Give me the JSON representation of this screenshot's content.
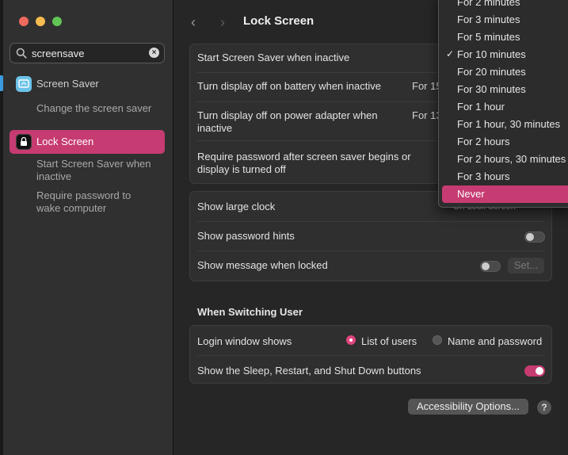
{
  "window": {
    "title": "Lock Screen"
  },
  "search": {
    "value": "screensave"
  },
  "sidebar": {
    "items": [
      {
        "label": "Screen Saver",
        "sub": [
          "Change the screen saver"
        ],
        "icon": "screen-saver-icon"
      },
      {
        "label": "Lock Screen",
        "sub": [
          "Start Screen Saver when inactive",
          "Require password to wake computer"
        ],
        "icon": "lock-screen-icon",
        "selected": true
      }
    ]
  },
  "settings": {
    "group1": [
      {
        "label": "Start Screen Saver when inactive"
      },
      {
        "label": "Turn display off on battery when inactive",
        "value": "For 15"
      },
      {
        "label": "Turn display off on power adapter when inactive",
        "value": "For 13"
      },
      {
        "label": "Require password after screen saver begins or display is turned off"
      }
    ],
    "group2": [
      {
        "label": "Show large clock",
        "value": "On Lock Screen"
      },
      {
        "label": "Show password hints",
        "toggle": false
      },
      {
        "label": "Show message when locked",
        "toggle": false,
        "button": "Set..."
      }
    ],
    "switching_header": "When Switching User",
    "group3": [
      {
        "label": "Login window shows",
        "options": [
          "List of users",
          "Name and password"
        ],
        "selected": "List of users"
      },
      {
        "label": "Show the Sleep, Restart, and Shut Down buttons",
        "toggle": true
      }
    ]
  },
  "footer": {
    "accessibility_button": "Accessibility Options...",
    "help": "?"
  },
  "dropdown": {
    "options": [
      "For 2 minutes",
      "For 3 minutes",
      "For 5 minutes",
      "For 10 minutes",
      "For 20 minutes",
      "For 30 minutes",
      "For 1 hour",
      "For 1 hour, 30 minutes",
      "For 2 hours",
      "For 2 hours, 30 minutes",
      "For 3 hours",
      "Never"
    ],
    "checked": "For 10 minutes",
    "highlighted": "Never",
    "check_mark": "✓"
  },
  "colors": {
    "accent": "#c63b72",
    "background": "#262626",
    "sidebar": "#303030"
  }
}
